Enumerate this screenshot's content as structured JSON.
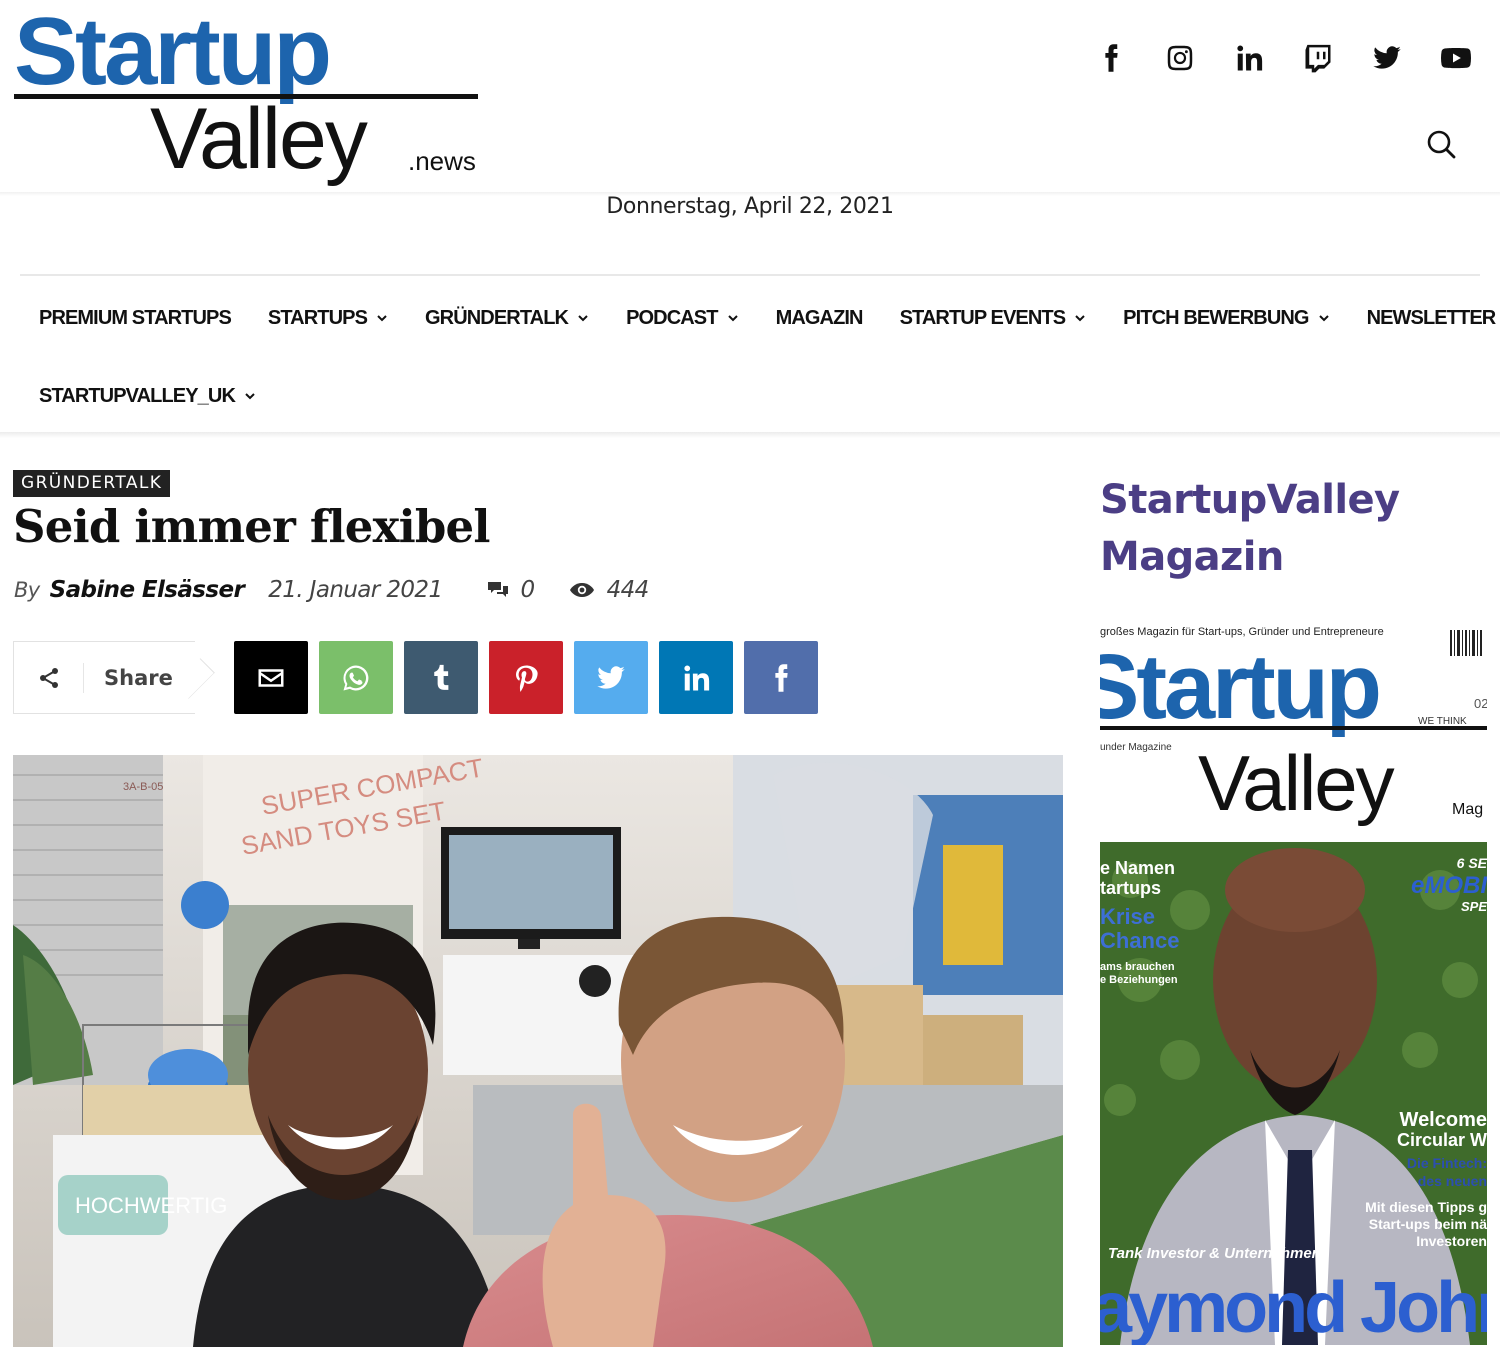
{
  "logo": {
    "main": "Startup",
    "sub": "Valley",
    "suffix": ".news"
  },
  "social_icons": [
    "facebook-icon",
    "instagram-icon",
    "linkedin-icon",
    "twitch-icon",
    "twitter-icon",
    "youtube-icon"
  ],
  "header": {
    "date": "Donnerstag, April 22, 2021"
  },
  "nav": {
    "items": [
      {
        "label": "PREMIUM STARTUPS",
        "dropdown": false
      },
      {
        "label": "STARTUPS",
        "dropdown": true
      },
      {
        "label": "GRÜNDERTALK",
        "dropdown": true
      },
      {
        "label": "PODCAST",
        "dropdown": true
      },
      {
        "label": "MAGAZIN",
        "dropdown": false
      },
      {
        "label": "STARTUP EVENTS",
        "dropdown": true
      },
      {
        "label": "PITCH BEWERBUNG",
        "dropdown": true
      },
      {
        "label": "NEWSLETTER",
        "dropdown": false
      },
      {
        "label": "STARTUPVALLEY_UK",
        "dropdown": true
      }
    ]
  },
  "article": {
    "category": "GRÜNDERTALK",
    "title": "Seid immer flexibel",
    "by": "By",
    "author": "Sabine Elsässer",
    "date": "21. Januar 2021",
    "comments": "0",
    "views": "444",
    "share_label": "Share",
    "share_buttons": [
      {
        "name": "email",
        "color": "#000000"
      },
      {
        "name": "whatsapp",
        "color": "#7bbf6a"
      },
      {
        "name": "tumblr",
        "color": "#3e5a70"
      },
      {
        "name": "pinterest",
        "color": "#ca212a"
      },
      {
        "name": "twitter",
        "color": "#55acee"
      },
      {
        "name": "linkedin",
        "color": "#0077b5"
      },
      {
        "name": "facebook",
        "color": "#516eab"
      }
    ],
    "photo_signs": {
      "sign1": "SUPER COMPACT",
      "sign2": "SAND TOYS SET",
      "bottom": "HOCHWERTIG",
      "booth": "3A-B-05"
    }
  },
  "sidebar": {
    "title_line1": "StartupValley",
    "title_line2": "Magazin",
    "cover": {
      "tagline": "großes Magazin für Start-ups, Gründer und Entrepreneure",
      "logo_top": "Startup",
      "logo_bottom": "Valley",
      "logo_suffix": "Mag",
      "founder": "under Magazine",
      "we_think": "WE THINK",
      "issue": "02",
      "left_lines": [
        "e Namen",
        "tartups",
        "Krise",
        "Chance",
        "ams brauchen",
        "e Beziehungen"
      ],
      "right_top": [
        "6 SE",
        "eMOBI",
        "SPE"
      ],
      "right_lines": [
        "Welcome",
        "Circular W",
        "Die Fintech:",
        "des neuen",
        "Mit diesen Tipps g",
        "Start-ups beim nä",
        "Investoren"
      ],
      "caption": "Tank Investor & Unternehmer",
      "name": "aymond John"
    }
  }
}
